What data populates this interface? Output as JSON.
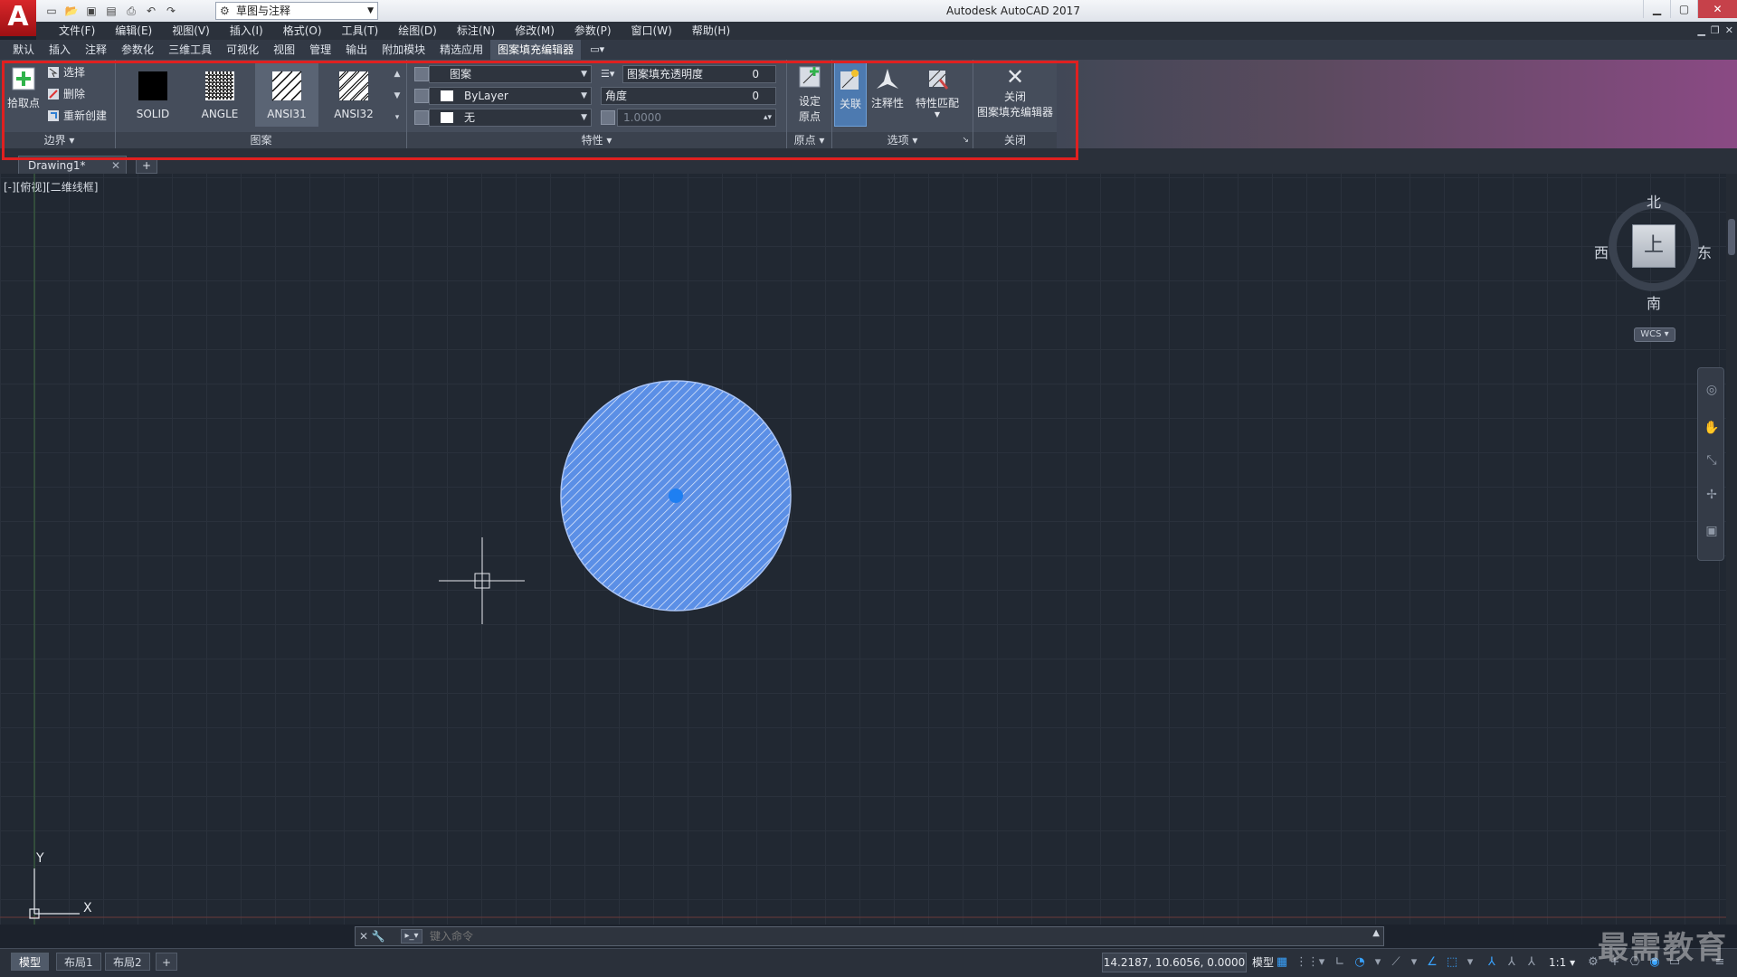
{
  "titlebar": {
    "app_logo": "A",
    "workspace": "草图与注释",
    "title": "Autodesk AutoCAD 2017"
  },
  "menu": [
    "文件(F)",
    "编辑(E)",
    "视图(V)",
    "插入(I)",
    "格式(O)",
    "工具(T)",
    "绘图(D)",
    "标注(N)",
    "修改(M)",
    "参数(P)",
    "窗口(W)",
    "帮助(H)"
  ],
  "ribbon_tabs": [
    "默认",
    "插入",
    "注释",
    "参数化",
    "三维工具",
    "可视化",
    "视图",
    "管理",
    "输出",
    "附加模块",
    "精选应用",
    "图案填充编辑器"
  ],
  "ribbon": {
    "boundary": {
      "pick_points": "拾取点",
      "select": "选择",
      "remove": "删除",
      "recreate": "重新创建",
      "title": "边界"
    },
    "pattern": {
      "title": "图案",
      "swatches": [
        "SOLID",
        "ANGLE",
        "ANSI31",
        "ANSI32"
      ],
      "active": "ANSI31"
    },
    "properties": {
      "title": "特性",
      "type": "图案",
      "color": "ByLayer",
      "background": "无",
      "transparency_label": "图案填充透明度",
      "transparency_value": "0",
      "angle_label": "角度",
      "angle_value": "0",
      "scale_value": "1.0000"
    },
    "origin": {
      "set_origin_line1": "设定",
      "set_origin_line2": "原点",
      "title": "原点"
    },
    "options": {
      "associative": "关联",
      "annotative": "注释性",
      "match_properties": "特性匹配",
      "title": "选项"
    },
    "close": {
      "line1": "关闭",
      "line2": "图案填充编辑器",
      "title": "关闭"
    }
  },
  "file_tab": {
    "name": "Drawing1*"
  },
  "viewport_label": "[-][俯视][二维线框]",
  "viewcube": {
    "north": "北",
    "south": "南",
    "east": "东",
    "west": "西",
    "face": "上",
    "wcs": "WCS"
  },
  "ucs": {
    "x": "X",
    "y": "Y"
  },
  "command": {
    "placeholder": "键入命令"
  },
  "status": {
    "layouts": [
      "模型",
      "布局1",
      "布局2"
    ],
    "coords": "14.2187, 10.6056, 0.0000",
    "model": "模型",
    "scale": "1:1"
  },
  "colors": {
    "hatch_fill": "#5b8fe6",
    "accent": "#39a3ff",
    "highlight": "#e02020"
  },
  "watermark": "最需教育"
}
